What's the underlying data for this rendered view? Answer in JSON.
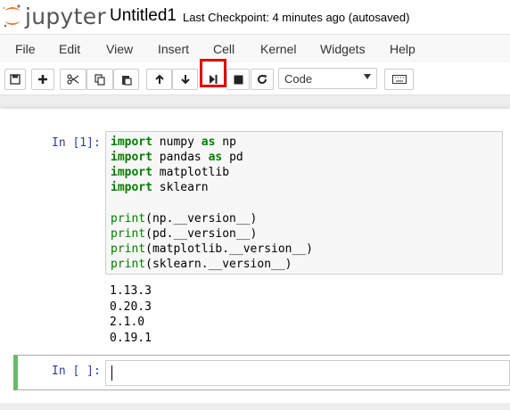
{
  "header": {
    "logo_text": "jupyter",
    "notebook_title": "Untitled1",
    "checkpoint_label": "Last Checkpoint:",
    "checkpoint_time": "4 minutes ago",
    "autosave_status": "(autosaved)"
  },
  "menu": [
    "File",
    "Edit",
    "View",
    "Insert",
    "Cell",
    "Kernel",
    "Widgets",
    "Help"
  ],
  "toolbar": {
    "cell_type": "Code",
    "buttons": [
      "save-icon",
      "plus-icon",
      "cut-icon",
      "copy-icon",
      "paste-icon",
      "arrow-up-icon",
      "arrow-down-icon",
      "run-icon",
      "stop-icon",
      "restart-icon",
      "keyboard-icon"
    ],
    "highlight_color": "#e00000"
  },
  "cells": [
    {
      "prompt": "In [1]:",
      "code": [
        [
          {
            "t": "import",
            "c": "kw"
          },
          {
            "t": " numpy "
          },
          {
            "t": "as",
            "c": "kw"
          },
          {
            "t": " np"
          }
        ],
        [
          {
            "t": "import",
            "c": "kw"
          },
          {
            "t": " pandas "
          },
          {
            "t": "as",
            "c": "kw"
          },
          {
            "t": " pd"
          }
        ],
        [
          {
            "t": "import",
            "c": "kw"
          },
          {
            "t": " matplotlib"
          }
        ],
        [
          {
            "t": "import",
            "c": "kw"
          },
          {
            "t": " sklearn"
          }
        ],
        [],
        [
          {
            "t": "print",
            "c": "bi"
          },
          {
            "t": "(np.__version__)"
          }
        ],
        [
          {
            "t": "print",
            "c": "bi"
          },
          {
            "t": "(pd.__version__)"
          }
        ],
        [
          {
            "t": "print",
            "c": "bi"
          },
          {
            "t": "(matplotlib.__version__)"
          }
        ],
        [
          {
            "t": "print",
            "c": "bi"
          },
          {
            "t": "(sklearn.__version__)"
          }
        ]
      ],
      "output": [
        "1.13.3",
        "0.20.3",
        "2.1.0",
        "0.19.1"
      ]
    },
    {
      "prompt": "In [ ]:",
      "code": []
    }
  ],
  "colors": {
    "keyword": "#008000",
    "prompt": "#303f9f",
    "active_cell_border": "#66bb6a"
  }
}
